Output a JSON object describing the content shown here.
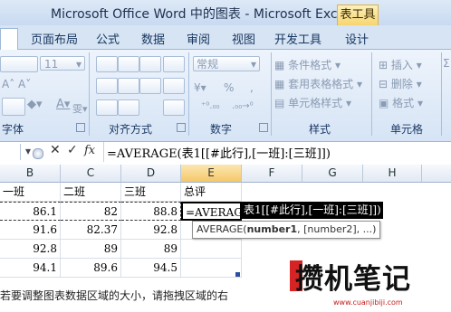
{
  "window": {
    "title": "Microsoft Office Word 中的图表 - Microsoft Excel",
    "context_tab": "表工具"
  },
  "tabs": [
    "页面布局",
    "公式",
    "数据",
    "审阅",
    "视图",
    "开发工具",
    "设计"
  ],
  "ribbon": {
    "font": {
      "size": "11",
      "group_label": "字体"
    },
    "alignment": {
      "group_label": "对齐方式"
    },
    "number": {
      "format": "常规",
      "percent": "%",
      "comma": ",",
      "group_label": "数字"
    },
    "styles": {
      "conditional_format": "条件格式",
      "table_format": "套用表格格式",
      "cell_styles": "单元格样式",
      "group_label": "样式"
    },
    "cells": {
      "insert": "插入",
      "delete": "删除",
      "format": "格式",
      "group_label": "单元格"
    }
  },
  "formula_bar": {
    "fx": "fx",
    "formula": "=AVERAGE(表1[[#此行],[一班]:[三班]])"
  },
  "columns": [
    "B",
    "C",
    "D",
    "E",
    "F",
    "G",
    "H"
  ],
  "table": {
    "headers": [
      "一班",
      "二班",
      "三班",
      "总评"
    ],
    "rows": [
      [
        "86.1",
        "82",
        "88.8",
        "=AVERAGE("
      ],
      [
        "91.6",
        "82.37",
        "92.8",
        ""
      ],
      [
        "92.8",
        "89",
        "89",
        ""
      ],
      [
        "94.1",
        "89.6",
        "94.5",
        ""
      ]
    ]
  },
  "edit_overlay": "表1[[#此行],[一班]:[三班]])",
  "tooltip": {
    "fn": "AVERAGE(",
    "arg1": "number1",
    "rest": ", [number2], ...)"
  },
  "status_hint": "若要调整图表数据区域的大小，请拖拽区域的右",
  "watermark": {
    "text": "攒机笔记",
    "url": "www.cuanjibiji.com"
  }
}
